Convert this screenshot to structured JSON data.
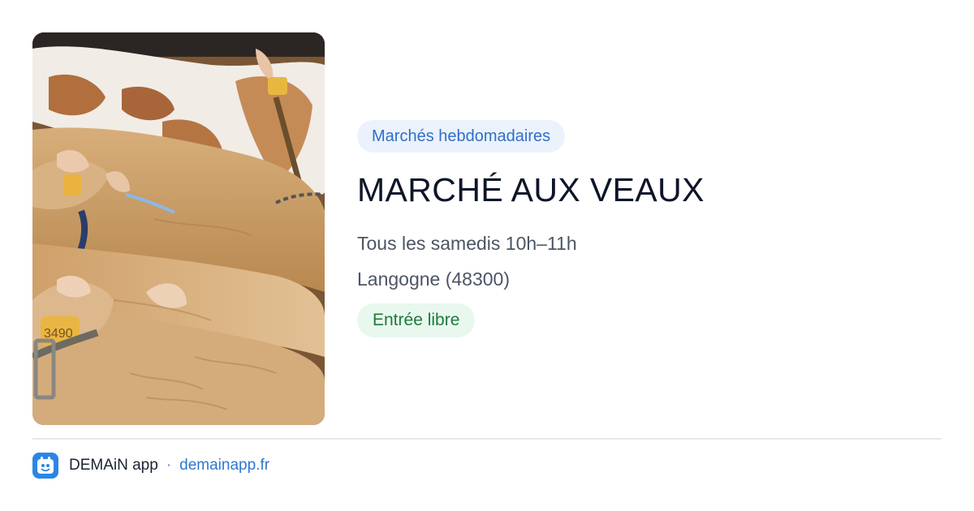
{
  "event": {
    "category": "Marchés hebdomadaires",
    "title": "MARCHÉ AUX VEAUX",
    "schedule": "Tous les samedis 10h–11h",
    "location": "Langogne (48300)",
    "entry": "Entrée libre"
  },
  "photo": {
    "subject": "calves at a livestock market",
    "ear_tag_text": "3490"
  },
  "footer": {
    "app_name": "DEMAiN app",
    "separator": "·",
    "link": "demainapp.fr"
  },
  "colors": {
    "category_text": "#2f6fc9",
    "category_bg": "#ebf2fb",
    "entry_text": "#1d7a3c",
    "entry_bg": "#e9f8ee",
    "link": "#2f77cf",
    "app_icon_bg": "#2a86e6"
  }
}
